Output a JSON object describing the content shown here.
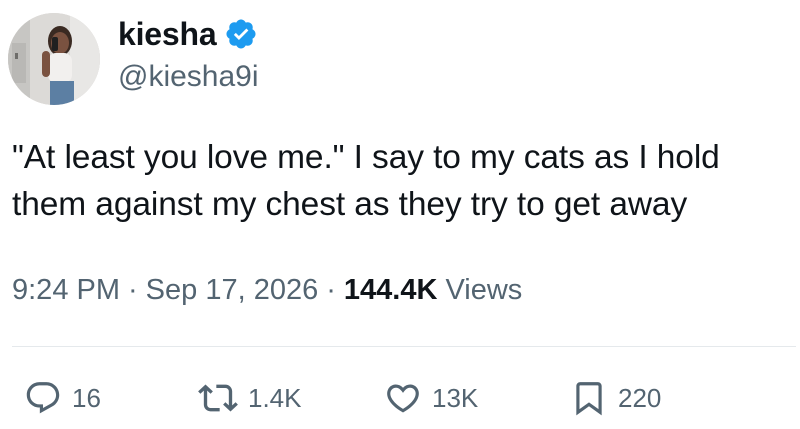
{
  "author": {
    "display_name": "kiesha",
    "handle": "@kiesha9i",
    "avatar_icon": "profile-photo",
    "verified_icon": "verified-badge-icon",
    "verified_color": "#1d9bf0"
  },
  "tweet": {
    "text_line_1": "\"At least you love me.\" I say to my cats as I hold",
    "text_line_2": "them against my chest as they try to get away"
  },
  "meta": {
    "time": "9:24 PM",
    "separator": "·",
    "date": "Sep 17, 2026",
    "views_count": "144.4K",
    "views_label": "Views"
  },
  "actions": {
    "replies": "16",
    "retweets": "1.4K",
    "likes": "13K",
    "bookmarks": "220"
  },
  "colors": {
    "text": "#0f1419",
    "secondary": "#536471",
    "divider": "#e5e9ec"
  }
}
